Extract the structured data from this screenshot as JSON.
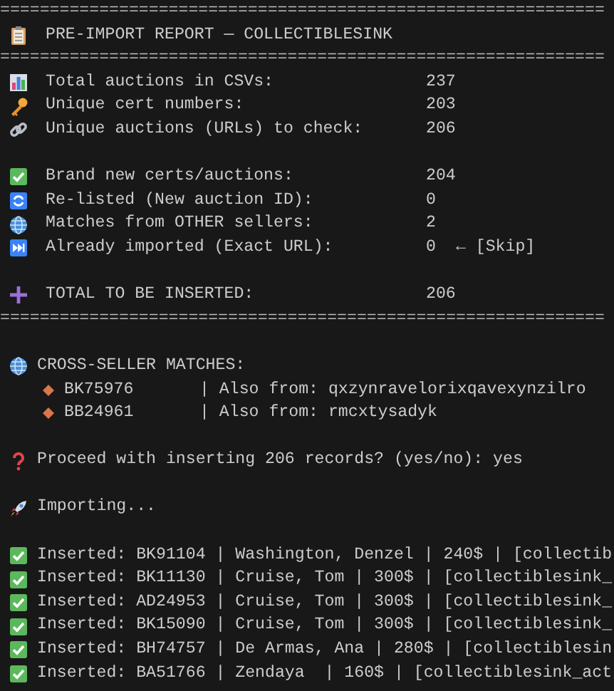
{
  "separator_top": "=============================================================",
  "title": {
    "kind": "clipboard",
    "text": "PRE-IMPORT REPORT — COLLECTIBLESINK"
  },
  "separator_mid": "=============================================================",
  "stat_groups": [
    [
      {
        "kind": "chart",
        "label": "Total auctions in CSVs:",
        "value": "237"
      },
      {
        "kind": "key",
        "label": "Unique cert numbers:",
        "value": "203"
      },
      {
        "kind": "link",
        "label": "Unique auctions (URLs) to check:",
        "value": "206"
      }
    ],
    [
      {
        "kind": "check",
        "label": "Brand new certs/auctions:",
        "value": "204"
      },
      {
        "kind": "refresh",
        "label": "Re-listed (New auction ID):",
        "value": "0"
      },
      {
        "kind": "globe",
        "label": "Matches from OTHER sellers:",
        "value": "2"
      },
      {
        "kind": "forward",
        "label": "Already imported (Exact URL):",
        "value": "0",
        "note": "← [Skip]"
      }
    ],
    [
      {
        "kind": "plus",
        "label": "TOTAL TO BE INSERTED:",
        "value": "206"
      }
    ]
  ],
  "separator_bottom": "=============================================================",
  "cross_seller": {
    "kind": "globe",
    "title": "CROSS-SELLER MATCHES:",
    "items": [
      {
        "code": "BK75976",
        "detail": "| Also from: qxzynravelorixqavexynzilro"
      },
      {
        "code": "BB24961",
        "detail": "| Also from: rmcxtysadyk"
      }
    ]
  },
  "prompt": {
    "kind": "question",
    "text": "Proceed with inserting 206 records? (yes/no): yes"
  },
  "status": {
    "kind": "rocket",
    "text": "Importing..."
  },
  "inserted": [
    {
      "kind": "check",
      "text": "Inserted: BK91104 | Washington, Denzel | 240$ | [collectib"
    },
    {
      "kind": "check",
      "text": "Inserted: BK11130 | Cruise, Tom | 300$ | [collectiblesink_"
    },
    {
      "kind": "check",
      "text": "Inserted: AD24953 | Cruise, Tom | 300$ | [collectiblesink_"
    },
    {
      "kind": "check",
      "text": "Inserted: BK15090 | Cruise, Tom | 300$ | [collectiblesink_"
    },
    {
      "kind": "check",
      "text": "Inserted: BH74757 | De Armas, Ana | 280$ | [collectiblesin"
    },
    {
      "kind": "check",
      "text": "Inserted: BA51766 | Zendaya  | 160$ | [collectiblesink_act"
    }
  ]
}
